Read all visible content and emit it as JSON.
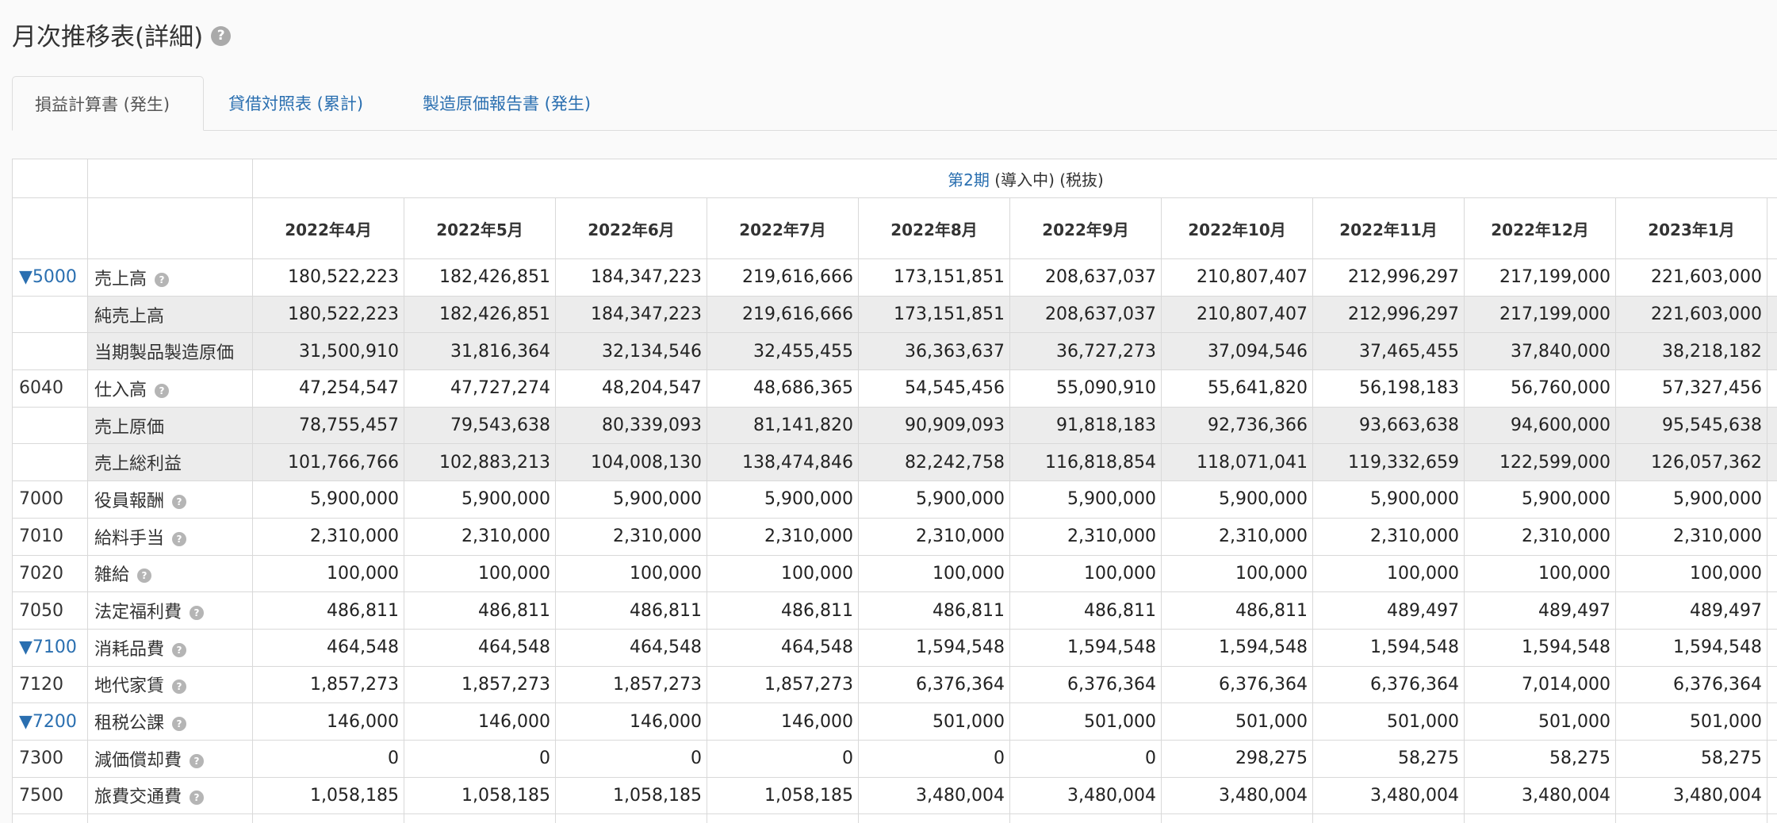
{
  "page": {
    "title": "月次推移表(詳細)",
    "help_glyph": "?"
  },
  "tabs": [
    {
      "label": "損益計算書 (発生)",
      "active": true
    },
    {
      "label": "貸借対照表 (累計)",
      "active": false
    },
    {
      "label": "製造原価報告書 (発生)",
      "active": false
    }
  ],
  "period": {
    "link": "第2期",
    "status": "(導入中) (税抜)"
  },
  "months": [
    "2022年4月",
    "2022年5月",
    "2022年6月",
    "2022年7月",
    "2022年8月",
    "2022年9月",
    "2022年10月",
    "2022年11月",
    "2022年12月",
    "2023年1月"
  ],
  "rows": [
    {
      "code": "▼5000",
      "name": "売上高",
      "help": true,
      "expandable": true,
      "sub": false,
      "values": [
        "180,522,223",
        "182,426,851",
        "184,347,223",
        "219,616,666",
        "173,151,851",
        "208,637,037",
        "210,807,407",
        "212,996,297",
        "217,199,000",
        "221,603,000"
      ]
    },
    {
      "code": "",
      "name": "純売上高",
      "help": false,
      "expandable": false,
      "sub": true,
      "values": [
        "180,522,223",
        "182,426,851",
        "184,347,223",
        "219,616,666",
        "173,151,851",
        "208,637,037",
        "210,807,407",
        "212,996,297",
        "217,199,000",
        "221,603,000"
      ]
    },
    {
      "code": "",
      "name": "当期製品製造原価",
      "help": false,
      "expandable": false,
      "sub": true,
      "values": [
        "31,500,910",
        "31,816,364",
        "32,134,546",
        "32,455,455",
        "36,363,637",
        "36,727,273",
        "37,094,546",
        "37,465,455",
        "37,840,000",
        "38,218,182"
      ]
    },
    {
      "code": "6040",
      "name": "仕入高",
      "help": true,
      "expandable": false,
      "sub": false,
      "values": [
        "47,254,547",
        "47,727,274",
        "48,204,547",
        "48,686,365",
        "54,545,456",
        "55,090,910",
        "55,641,820",
        "56,198,183",
        "56,760,000",
        "57,327,456"
      ]
    },
    {
      "code": "",
      "name": "売上原価",
      "help": false,
      "expandable": false,
      "sub": true,
      "values": [
        "78,755,457",
        "79,543,638",
        "80,339,093",
        "81,141,820",
        "90,909,093",
        "91,818,183",
        "92,736,366",
        "93,663,638",
        "94,600,000",
        "95,545,638"
      ]
    },
    {
      "code": "",
      "name": "売上総利益",
      "help": false,
      "expandable": false,
      "sub": true,
      "values": [
        "101,766,766",
        "102,883,213",
        "104,008,130",
        "138,474,846",
        "82,242,758",
        "116,818,854",
        "118,071,041",
        "119,332,659",
        "122,599,000",
        "126,057,362"
      ]
    },
    {
      "code": "7000",
      "name": "役員報酬",
      "help": true,
      "expandable": false,
      "sub": false,
      "values": [
        "5,900,000",
        "5,900,000",
        "5,900,000",
        "5,900,000",
        "5,900,000",
        "5,900,000",
        "5,900,000",
        "5,900,000",
        "5,900,000",
        "5,900,000"
      ]
    },
    {
      "code": "7010",
      "name": "給料手当",
      "help": true,
      "expandable": false,
      "sub": false,
      "values": [
        "2,310,000",
        "2,310,000",
        "2,310,000",
        "2,310,000",
        "2,310,000",
        "2,310,000",
        "2,310,000",
        "2,310,000",
        "2,310,000",
        "2,310,000"
      ]
    },
    {
      "code": "7020",
      "name": "雑給",
      "help": true,
      "expandable": false,
      "sub": false,
      "values": [
        "100,000",
        "100,000",
        "100,000",
        "100,000",
        "100,000",
        "100,000",
        "100,000",
        "100,000",
        "100,000",
        "100,000"
      ]
    },
    {
      "code": "7050",
      "name": "法定福利費",
      "help": true,
      "expandable": false,
      "sub": false,
      "values": [
        "486,811",
        "486,811",
        "486,811",
        "486,811",
        "486,811",
        "486,811",
        "486,811",
        "489,497",
        "489,497",
        "489,497"
      ]
    },
    {
      "code": "▼7100",
      "name": "消耗品費",
      "help": true,
      "expandable": true,
      "sub": false,
      "values": [
        "464,548",
        "464,548",
        "464,548",
        "464,548",
        "1,594,548",
        "1,594,548",
        "1,594,548",
        "1,594,548",
        "1,594,548",
        "1,594,548"
      ]
    },
    {
      "code": "7120",
      "name": "地代家賃",
      "help": true,
      "expandable": false,
      "sub": false,
      "values": [
        "1,857,273",
        "1,857,273",
        "1,857,273",
        "1,857,273",
        "6,376,364",
        "6,376,364",
        "6,376,364",
        "6,376,364",
        "7,014,000",
        "6,376,364"
      ]
    },
    {
      "code": "▼7200",
      "name": "租税公課",
      "help": true,
      "expandable": true,
      "sub": false,
      "values": [
        "146,000",
        "146,000",
        "146,000",
        "146,000",
        "501,000",
        "501,000",
        "501,000",
        "501,000",
        "501,000",
        "501,000"
      ]
    },
    {
      "code": "7300",
      "name": "減価償却費",
      "help": true,
      "expandable": false,
      "sub": false,
      "values": [
        "0",
        "0",
        "0",
        "0",
        "0",
        "0",
        "298,275",
        "58,275",
        "58,275",
        "58,275"
      ]
    },
    {
      "code": "7500",
      "name": "旅費交通費",
      "help": true,
      "expandable": false,
      "sub": false,
      "values": [
        "1,058,185",
        "1,058,185",
        "1,058,185",
        "1,058,185",
        "3,480,004",
        "3,480,004",
        "3,480,004",
        "3,480,004",
        "3,480,004",
        "3,480,004"
      ]
    }
  ],
  "colors": {
    "link": "#2a6fb0",
    "subtotal_bg": "#ececec",
    "border": "#d9d9d9"
  }
}
